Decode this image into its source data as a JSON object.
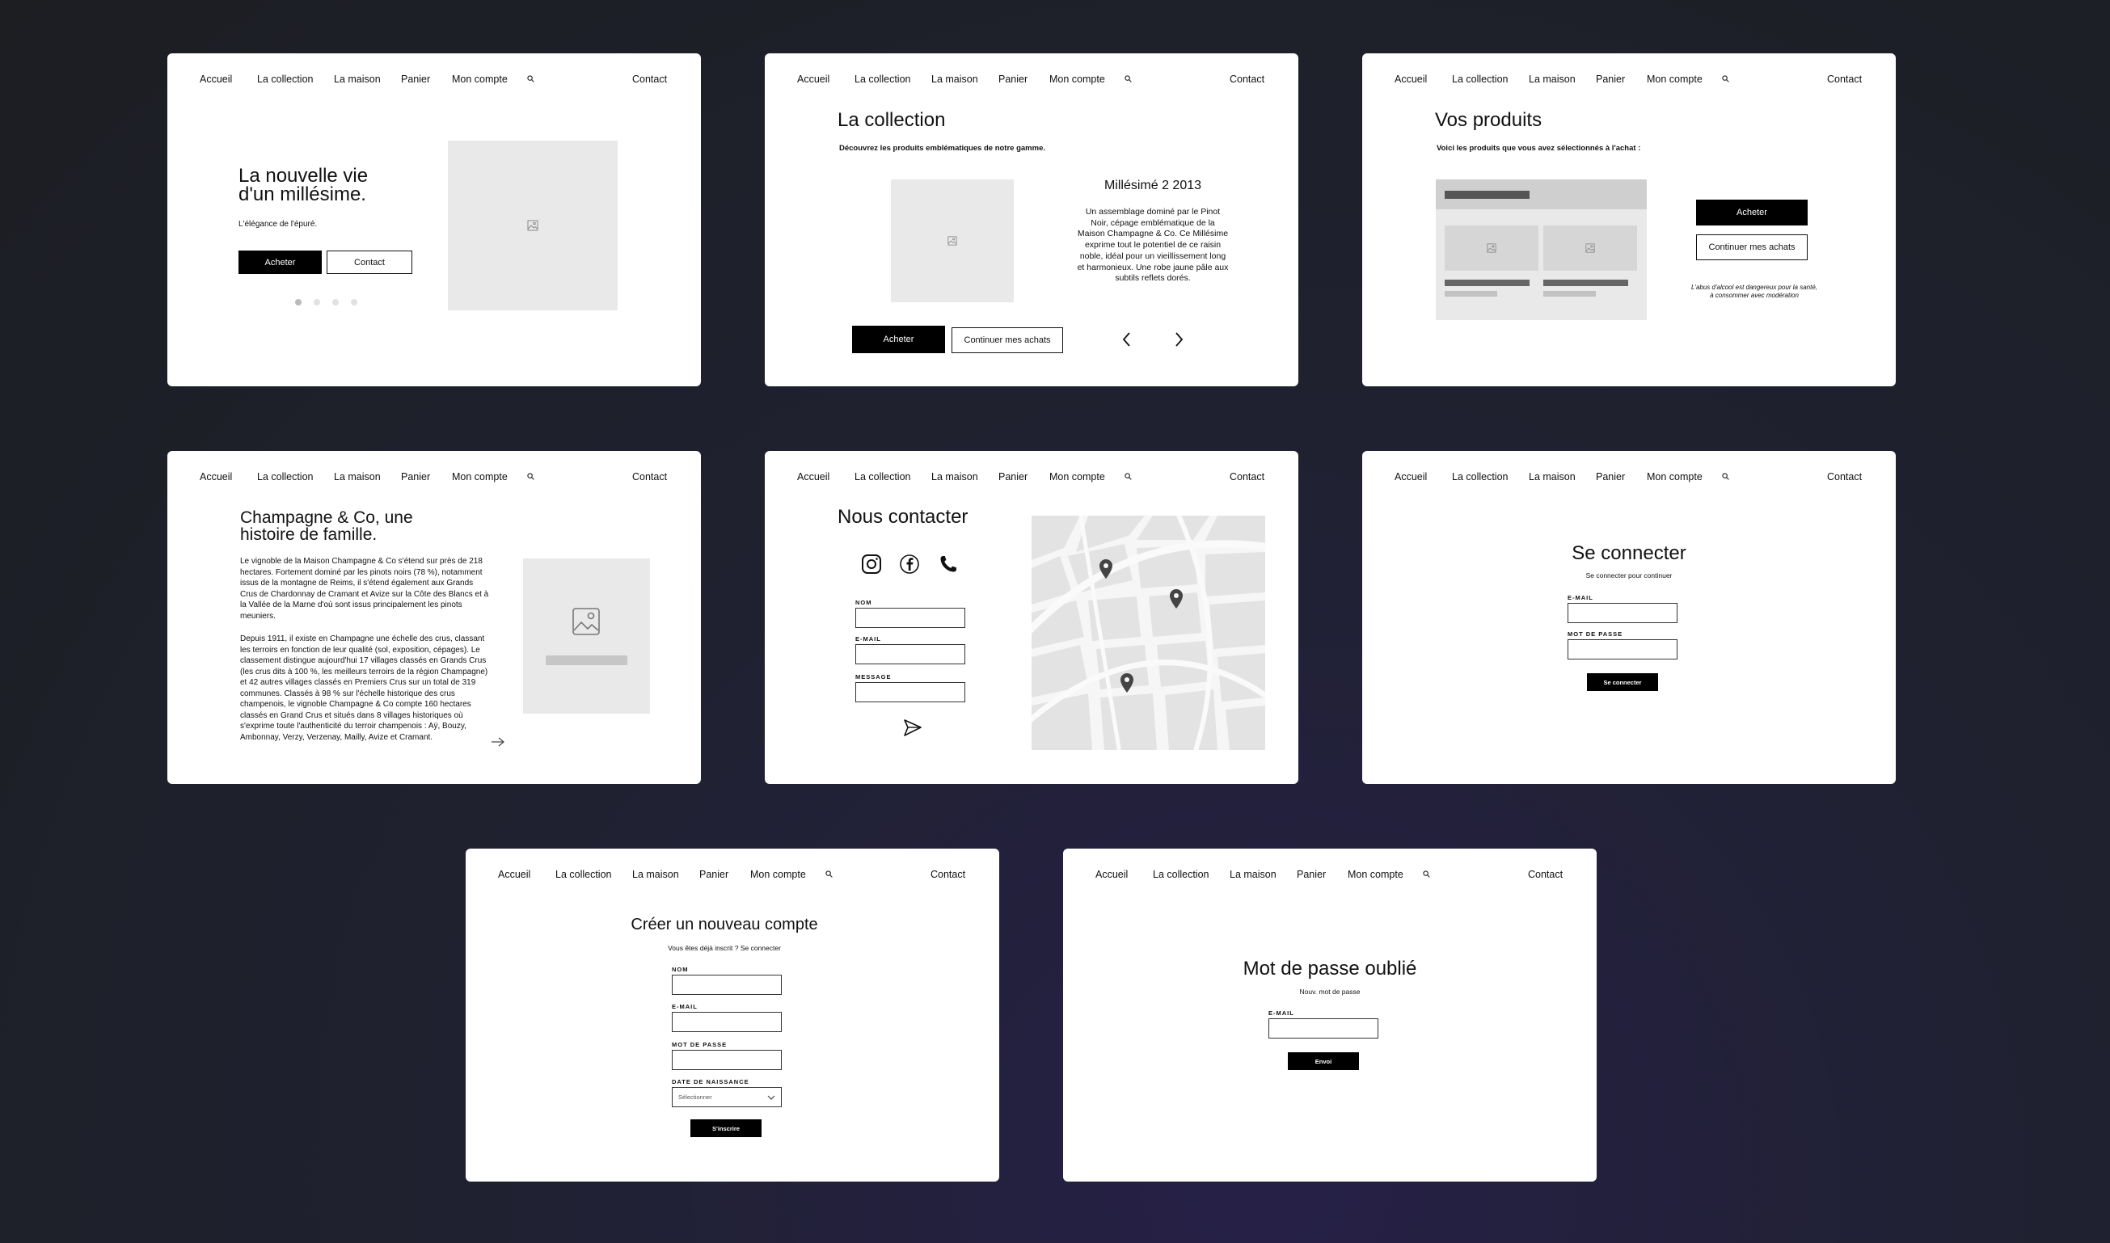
{
  "nav": {
    "items": [
      "Accueil",
      "La collection",
      "La maison",
      "Panier",
      "Mon compte"
    ],
    "contact": "Contact",
    "search_icon": "search-icon"
  },
  "home": {
    "title_line1": "La nouvelle vie",
    "title_line2": "d'un millésime.",
    "subtitle": "L'élégance de l'épuré.",
    "buy": "Acheter",
    "contact": "Contact",
    "carousel_dots": 4,
    "carousel_active": 1
  },
  "collection": {
    "title": "La collection",
    "subtitle": "Découvrez les produits emblématiques de notre gamme.",
    "product_title": "Millésimé 2 2013",
    "product_desc": "Un assemblage dominé par le Pinot Noir, cépage emblématique de la Maison Champagne & Co. Ce Millésime exprime tout le potentiel de ce raisin noble, idéal pour un vieillissement long et harmonieux. Une robe jaune pâle aux subtils reflets dorés.",
    "buy": "Acheter",
    "continue": "Continuer mes achats"
  },
  "products": {
    "title": "Vos produits",
    "subtitle": "Voici les produits que vous avez sélectionnés à l'achat :",
    "buy": "Acheter",
    "continue": "Continuer mes achats",
    "warning_line1": "L'abus d'alcool est dangereux pour la santé,",
    "warning_line2": "à consommer avec modération"
  },
  "maison": {
    "title_line1": "Champagne & Co, une",
    "title_line2": "histoire de famille.",
    "para1": "Le vignoble de la Maison Champagne & Co s'étend sur près de 218 hectares. Fortement dominé par les pinots noirs (78 %), notamment issus de la montagne de Reims, il s'étend également aux Grands Crus de Chardonnay de Cramant et Avize sur la Côte des Blancs et à la Vallée de la Marne d'où sont issus principalement les pinots meuniers.",
    "para2": "Depuis 1911, il existe en Champagne une échelle des crus, classant les terroirs en fonction de leur qualité (sol, exposition, cépages). Le classement distingue aujourd'hui 17 villages classés en Grands Crus (les crus dits à 100 %, les meilleurs terroirs de la région Champagne) et 42 autres villages classés en Premiers Crus sur un total de 319 communes. Classés à 98 % sur l'échelle historique des crus champenois, le vignoble Champagne & Co compte 160 hectares classés en Grand Crus et situés dans 8 villages historiques où s'exprime toute l'authenticité du terroir champenois : Aÿ, Bouzy, Ambonnay, Verzy, Verzenay, Mailly, Avize et Cramant."
  },
  "contact": {
    "title": "Nous contacter",
    "name_label": "NOM",
    "email_label": "E-MAIL",
    "message_label": "MESSAGE",
    "social_icons": [
      "instagram-icon",
      "facebook-icon",
      "phone-icon"
    ]
  },
  "login": {
    "title": "Se connecter",
    "subtitle": "Se connecter pour continuer",
    "email_label": "E-MAIL",
    "password_label": "MOT DE PASSE",
    "submit": "Se connecter"
  },
  "signup": {
    "title": "Créer un nouveau compte",
    "subtitle": "Vous êtes déjà inscrit ? Se connecter",
    "name_label": "NOM",
    "email_label": "E-MAIL",
    "password_label": "MOT DE PASSE",
    "birth_label": "DATE DE NAISSANCE",
    "birth_value": "Sélectionner",
    "submit": "S'inscrire"
  },
  "forgot": {
    "title": "Mot de passe oublié",
    "subtitle": "Nouv. mot de passe",
    "email_label": "E-MAIL",
    "submit": "Envoi"
  },
  "colors": {
    "background": "#1e2027",
    "card": "#ffffff",
    "placeholder": "#e9e9e9",
    "accent": "#000000"
  }
}
